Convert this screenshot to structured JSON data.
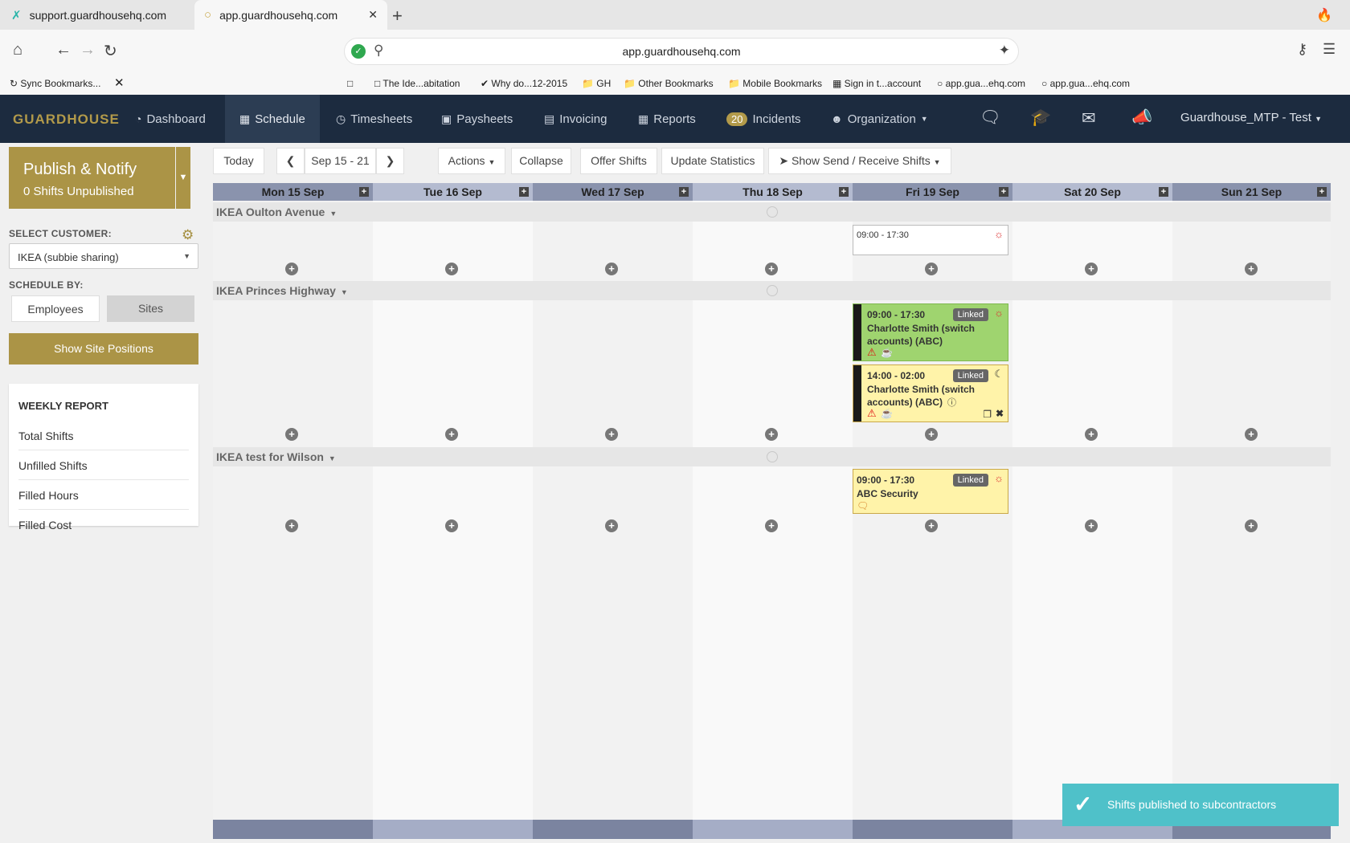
{
  "browser": {
    "tabs": [
      {
        "title": "support.guardhousehq.com"
      },
      {
        "title": "app.guardhousehq.com"
      }
    ],
    "url": "app.guardhousehq.com",
    "bookmarks": [
      "Sync Bookmarks...",
      "The Ide...abitation",
      "Why do...12-2015",
      "GH",
      "Other Bookmarks",
      "Mobile Bookmarks",
      "Sign in t...account",
      "app.gua...ehq.com",
      "app.gua...ehq.com"
    ]
  },
  "app": {
    "logo": "GUARDHOUSE",
    "nav": [
      "Dashboard",
      "Schedule",
      "Timesheets",
      "Paysheets",
      "Invoicing",
      "Reports",
      "Incidents",
      "Organization"
    ],
    "incidents_count": "20",
    "user": "Guardhouse_MTP - Test"
  },
  "sidebar": {
    "publish_title": "Publish & Notify",
    "publish_sub": "0 Shifts Unpublished",
    "select_customer_label": "SELECT CUSTOMER:",
    "customer": "IKEA (subbie sharing)",
    "schedule_by_label": "SCHEDULE BY:",
    "schedule_by": [
      "Employees",
      "Sites"
    ],
    "show_positions": "Show Site Positions",
    "report_title": "WEEKLY REPORT",
    "report_items": [
      "Total Shifts",
      "Unfilled Shifts",
      "Filled Hours",
      "Filled Cost"
    ]
  },
  "toolbar": {
    "today": "Today",
    "range": "Sep 15 - 21",
    "actions": "Actions",
    "collapse": "Collapse",
    "offer": "Offer Shifts",
    "update": "Update Statistics",
    "send_receive": "Show Send / Receive Shifts"
  },
  "days": [
    "Mon 15 Sep",
    "Tue 16 Sep",
    "Wed 17 Sep",
    "Thu 18 Sep",
    "Fri 19 Sep",
    "Sat 20 Sep",
    "Sun 21 Sep"
  ],
  "sites": [
    "IKEA Oulton Avenue",
    "IKEA Princes Highway",
    "IKEA test for Wilson"
  ],
  "shifts": [
    {
      "time": "09:00 - 17:30",
      "name": ""
    },
    {
      "time": "09:00 - 17:30",
      "linked": "Linked",
      "name": "Charlotte Smith (switch accounts) (ABC)"
    },
    {
      "time": "14:00 - 02:00",
      "linked": "Linked",
      "name": "Charlotte Smith (switch accounts) (ABC)"
    },
    {
      "time": "09:00 - 17:30",
      "linked": "Linked",
      "name": "ABC Security"
    }
  ],
  "toast": "Shifts published to subcontractors",
  "colors": {
    "nav_bg": "#1c2b3f",
    "gold": "#ab9446",
    "toast": "#4fc1c9",
    "shift_green": "#9fd46f",
    "shift_yellow": "#fff3a9"
  }
}
